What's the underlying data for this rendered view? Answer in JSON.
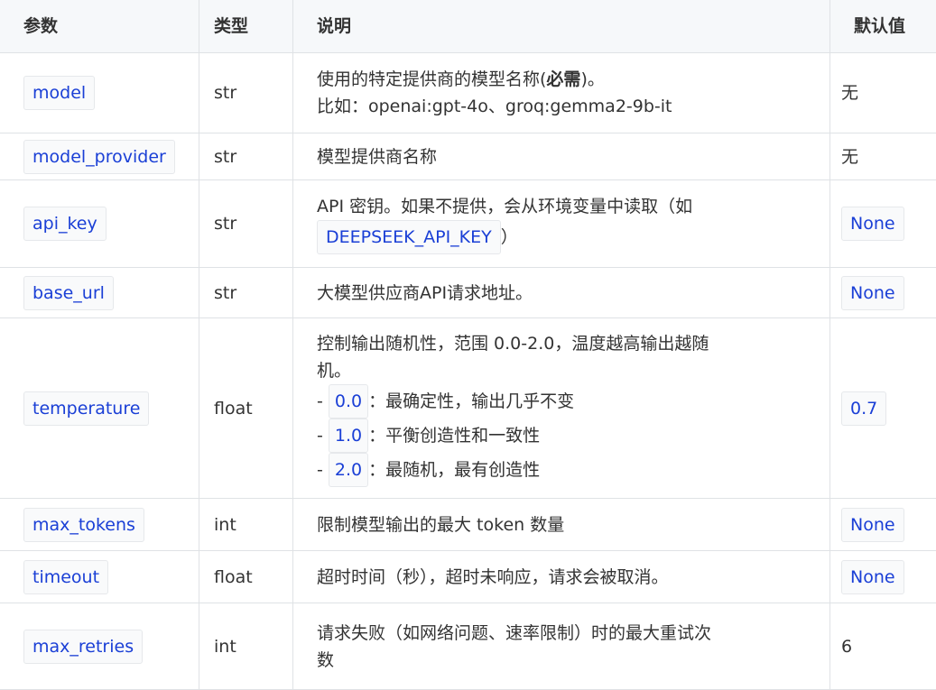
{
  "headers": [
    "参数",
    "类型",
    "说明",
    "默认值"
  ],
  "rows": [
    {
      "param": "model",
      "type": "str",
      "desc_pre": "使用的特定提供商的模型名称(",
      "desc_bold": "必需",
      "desc_post": ")。",
      "desc_line2": "比如：openai:gpt-4o、groq:gemma2-9b-it",
      "default": "无",
      "default_code": false
    },
    {
      "param": "model_provider",
      "type": "str",
      "desc": "模型提供商名称",
      "default": "无",
      "default_code": false
    },
    {
      "param": "api_key",
      "type": "str",
      "desc": "API 密钥。如果不提供，会从环境变量中读取（如",
      "desc_code": "DEEPSEEK_API_KEY",
      "desc_tail": "）",
      "default": "None",
      "default_code": true
    },
    {
      "param": "base_url",
      "type": "str",
      "desc": "大模型供应商API请求地址。",
      "default": "None",
      "default_code": true
    },
    {
      "param": "temperature",
      "type": "float",
      "desc_line1": "控制输出随机性，范围 0.0-2.0，温度越高输出越随",
      "desc_line2": "机。",
      "items": [
        {
          "dash": "-",
          "code": "0.0",
          "text": "：最确定性，输出几乎不变"
        },
        {
          "dash": "-",
          "code": "1.0",
          "text": "：平衡创造性和一致性"
        },
        {
          "dash": "-",
          "code": "2.0",
          "text": "：最随机，最有创造性"
        }
      ],
      "default": "0.7",
      "default_code": true
    },
    {
      "param": "max_tokens",
      "type": "int",
      "desc": "限制模型输出的最大 token 数量",
      "default": "None",
      "default_code": true
    },
    {
      "param": "timeout",
      "type": "float",
      "desc": "超时时间（秒），超时未响应，请求会被取消。",
      "default": "None",
      "default_code": true
    },
    {
      "param": "max_retries",
      "type": "int",
      "desc_line1": "请求失败（如网络问题、速率限制）时的最大重试次",
      "desc_line2": "数",
      "default": "6",
      "default_code": false
    }
  ]
}
